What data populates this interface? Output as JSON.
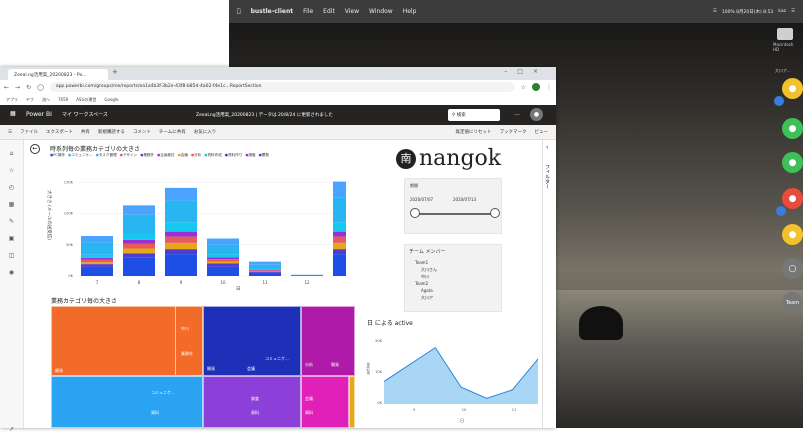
{
  "mac": {
    "apple_icon": "apple-icon",
    "app_name": "bustle-client",
    "menus": [
      "File",
      "Edit",
      "View",
      "Window",
      "Help"
    ],
    "status": "100%  8月20日(木) 8:53",
    "user": "kaz",
    "disk_label": "Macintosh HD",
    "sidebar_label": "大川ア..."
  },
  "dock": [
    {
      "icon": "person-icon",
      "color": "#f2c12e"
    },
    {
      "icon": "person-icon",
      "color": "#3fbf5a"
    },
    {
      "icon": "person-icon",
      "color": "#3fbf5a"
    },
    {
      "icon": "person-icon",
      "color": "#e74c3c"
    },
    {
      "icon": "person-icon",
      "color": "#f2c12e"
    },
    {
      "icon": "broadcast-icon",
      "color": "#777777"
    },
    {
      "label": "Team",
      "icon": "team-icon",
      "color": "#777777"
    }
  ],
  "browser": {
    "tab_title": "Zeeal.ng活用案_20200823 - Po...",
    "url": "app.powerbi.com/groups/me/reports/ea1a4b3f-3b2e-43f8-b85d-4a02-f4e1c...ReportSection",
    "bookmarks": [
      "アプリ",
      "ヤフ",
      "流へ",
      "7659",
      "ASUの運営",
      "Google"
    ]
  },
  "pbi": {
    "app": "Power BI",
    "workspace": "マイ ワークスペース",
    "report_title": "ZeeaLng活用案_20200823 | データは 20/8/24 に更新されました",
    "search": "検索",
    "tools": [
      "ファイル",
      "エクスポート",
      "共有",
      "新規購読する",
      "コメント",
      "チームに共有",
      "お気に入り"
    ],
    "tools_right": [
      "既定値にリセット",
      "ブックマーク",
      "ビュー"
    ],
    "filter_label": "フィルター"
  },
  "chart_data": {
    "type": "bar",
    "title": "時系列毎の業務カテゴリの大きさ",
    "ylabel": "大きさ (メールの送受信)",
    "xlabel": "日",
    "categories": [
      "7",
      "8",
      "9",
      "10",
      "11",
      "12",
      "13"
    ],
    "ylim": [
      0,
      160
    ],
    "legend": [
      "PC操作",
      "コミュニケ...",
      "タスク管理",
      "デザイン",
      "業務外",
      "企画検討",
      "会議",
      "分析",
      "資料作成",
      "資料作り",
      "調査",
      "開発"
    ],
    "series": [
      {
        "name": "開発",
        "values": [
          15,
          30,
          35,
          15,
          5,
          0,
          35
        ],
        "color": "#1f4ee6"
      },
      {
        "name": "会議",
        "values": [
          4,
          6,
          8,
          5,
          2,
          1,
          8
        ],
        "color": "#4c3ed1"
      },
      {
        "name": "分析",
        "values": [
          3,
          8,
          10,
          3,
          1,
          0,
          10
        ],
        "color": "#e6a817"
      },
      {
        "name": "デザイン",
        "values": [
          4,
          8,
          10,
          4,
          1,
          0,
          10
        ],
        "color": "#e65c5c"
      },
      {
        "name": "企画検討",
        "values": [
          3,
          6,
          8,
          3,
          1,
          0,
          8
        ],
        "color": "#9b2fcf"
      },
      {
        "name": "資料作成",
        "values": [
          5,
          10,
          15,
          5,
          2,
          0,
          15
        ],
        "color": "#14c8f0"
      },
      {
        "name": "コミュニケ...",
        "values": [
          20,
          30,
          35,
          15,
          6,
          0,
          40
        ],
        "color": "#29b4f2"
      },
      {
        "name": "タスク管理",
        "values": [
          10,
          15,
          20,
          10,
          5,
          1,
          25
        ],
        "color": "#4aa3ff"
      },
      {
        "name": "調査",
        "values": [
          0,
          0,
          0,
          0,
          0,
          0,
          0
        ],
        "color": "#1546a8"
      }
    ],
    "yticks": [
      "0K",
      "50K",
      "100K",
      "150K"
    ]
  },
  "logo": {
    "text": "nangok",
    "icon": "nangok-logo-icon"
  },
  "slicer": {
    "label": "期間",
    "from": "2020/07/07",
    "to": "2020/07/13",
    "value_range": [
      0,
      1
    ]
  },
  "team": {
    "label": "チーム メンバー",
    "items": [
      "Team1",
      "大川さん",
      "中川",
      "Team2",
      "Agata",
      "大川ア"
    ]
  },
  "treemap": {
    "title": "業務カテゴリ毎の大きさ",
    "cells_left": [
      {
        "label": "開発",
        "color": "#f26b28"
      },
      {
        "label": "中川",
        "color": "#f26b28"
      },
      {
        "label": "コミュニケ...",
        "color": "#29a3f2"
      },
      {
        "label": "業務外",
        "color": "#f26b28"
      },
      {
        "label": "資料",
        "color": "#29a3f2"
      }
    ],
    "cells_mid": [
      {
        "label": "開発",
        "color": "#1e2fb8"
      },
      {
        "label": "会議",
        "color": "#1e2fb8"
      },
      {
        "label": "コミュニケ...",
        "color": "#1e2fb8"
      },
      {
        "label": "調査",
        "color": "#8c3fd9"
      },
      {
        "label": "資料",
        "color": "#8c3fd9"
      }
    ],
    "cells_right": [
      {
        "label": "分析",
        "color": "#b01aa8"
      },
      {
        "label": "開発",
        "color": "#b01aa8"
      },
      {
        "label": "会議",
        "color": "#e020b8"
      },
      {
        "label": "資料",
        "color": "#e020b8"
      }
    ]
  },
  "line_chart": {
    "title": "日 による active",
    "xticks": [
      "9",
      "10",
      "11"
    ],
    "xlabel": "日",
    "ylabel": "active",
    "yticks": [
      "20K",
      "10K",
      "0K"
    ],
    "values": [
      8,
      14,
      20,
      6,
      2,
      5,
      16
    ]
  }
}
